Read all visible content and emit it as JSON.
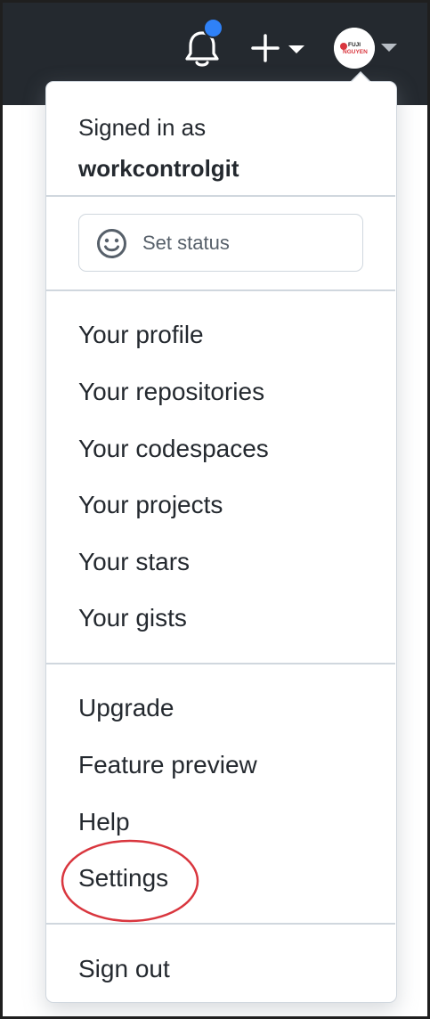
{
  "header": {
    "notifications_icon": "bell-icon",
    "create_icon": "plus-icon",
    "dropdown_icon": "caret-down-icon",
    "avatar_text_top": "FUJI",
    "avatar_text_bottom": "NGUYEN",
    "notification_dot_color": "#2f81f7"
  },
  "menu": {
    "signed_in_label": "Signed in as",
    "username": "workcontrolgit",
    "set_status_label": "Set status",
    "profile_items": [
      "Your profile",
      "Your repositories",
      "Your codespaces",
      "Your projects",
      "Your stars",
      "Your gists"
    ],
    "help_items": [
      "Upgrade",
      "Feature preview",
      "Help",
      "Settings"
    ],
    "sign_out_label": "Sign out"
  },
  "annotation": {
    "highlighted_item": "Settings",
    "ring_color": "#d9363e"
  }
}
